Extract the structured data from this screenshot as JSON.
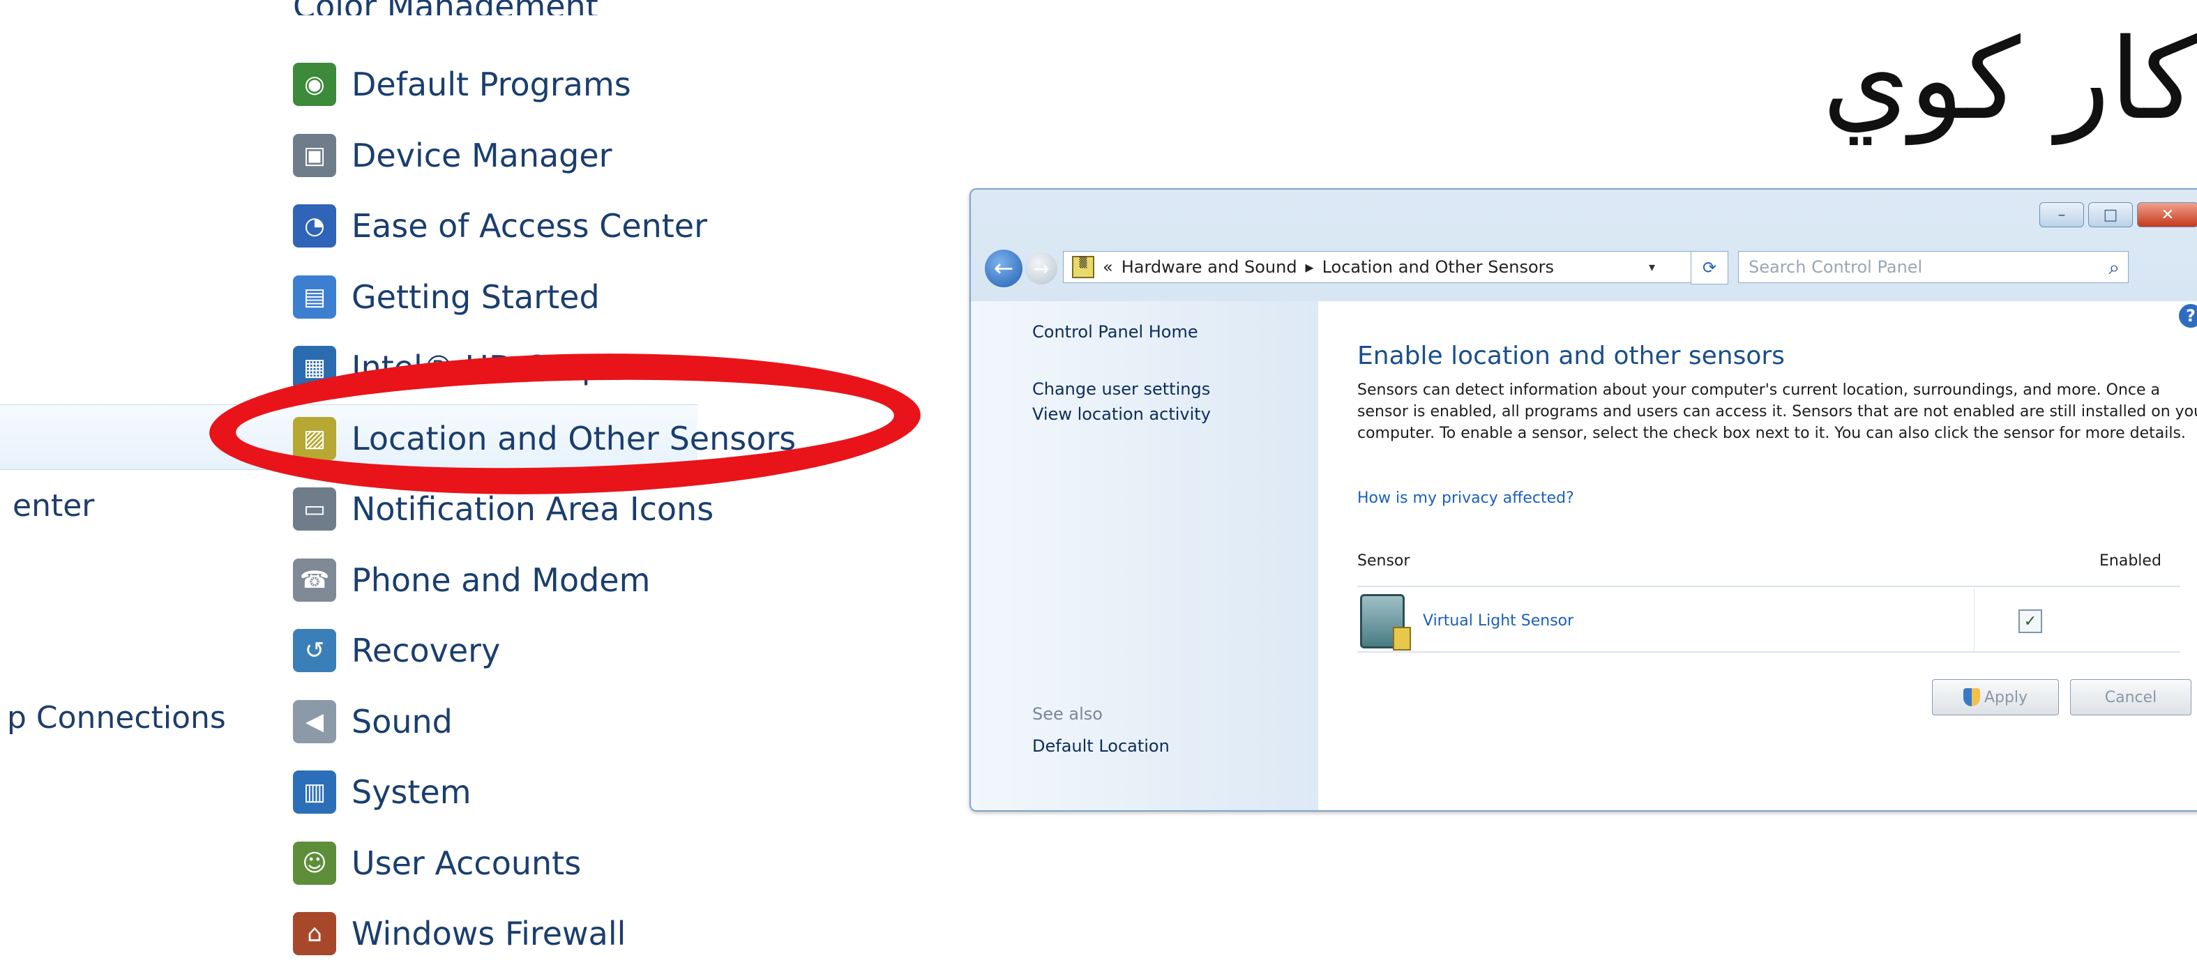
{
  "left_panel": {
    "cut_top_item": "Color Management",
    "fragments": {
      "top_left": "...",
      "enter": "enter",
      "connections": "p Connections"
    },
    "items": [
      {
        "label": "Default Programs",
        "icon": "default-programs-icon",
        "color": "#3d8a3a"
      },
      {
        "label": "Device Manager",
        "icon": "device-manager-icon",
        "color": "#6f7d8a"
      },
      {
        "label": "Ease of Access Center",
        "icon": "ease-of-access-icon",
        "color": "#2f64b8"
      },
      {
        "label": "Getting Started",
        "icon": "getting-started-icon",
        "color": "#3c7fd1"
      },
      {
        "label": "Intel® HD Graphics",
        "icon": "graphics-icon",
        "color": "#2b6bb0"
      },
      {
        "label": "Location and Other Sensors",
        "icon": "location-sensors-icon",
        "color": "#b6a832"
      },
      {
        "label": "Notification Area Icons",
        "icon": "notification-icon",
        "color": "#6f7d8a"
      },
      {
        "label": "Phone and Modem",
        "icon": "phone-modem-icon",
        "color": "#7f8a96"
      },
      {
        "label": "Recovery",
        "icon": "recovery-icon",
        "color": "#3b7fb8"
      },
      {
        "label": "Sound",
        "icon": "sound-icon",
        "color": "#8b9aa6"
      },
      {
        "label": "System",
        "icon": "system-icon",
        "color": "#2c6fb8"
      },
      {
        "label": "User Accounts",
        "icon": "user-accounts-icon",
        "color": "#5e8e3a"
      },
      {
        "label": "Windows Firewall",
        "icon": "firewall-icon",
        "color": "#a8482a"
      }
    ]
  },
  "arabic_caption": "كار كوي",
  "highlight_color": "#e8141a",
  "window": {
    "title_buttons": {
      "minimize": "–",
      "maximize": "□",
      "close": "✕"
    },
    "address": {
      "chevron": "«",
      "crumb1": "Hardware and Sound",
      "separator": "▸",
      "crumb2": "Location and Other Sensors"
    },
    "search_placeholder": "Search Control Panel",
    "sidebar": {
      "home": "Control Panel Home",
      "change_settings": "Change user settings",
      "view_activity": "View location activity",
      "see_also": "See also",
      "default_location": "Default Location"
    },
    "main": {
      "title": "Enable location and other sensors",
      "description": "Sensors can detect information about your computer's current location, surroundings, and more. Once a sensor is enabled, all programs and users can access it. Sensors that are not enabled are still installed on your computer. To enable a sensor, select the check box next to it. You can also click the sensor for more details.",
      "privacy_link": "How is my privacy affected?",
      "col_sensor": "Sensor",
      "col_enabled": "Enabled",
      "sensor_name": "Virtual Light Sensor",
      "sensor_enabled": true,
      "check_mark": "✓",
      "apply": "Apply",
      "cancel": "Cancel"
    }
  }
}
